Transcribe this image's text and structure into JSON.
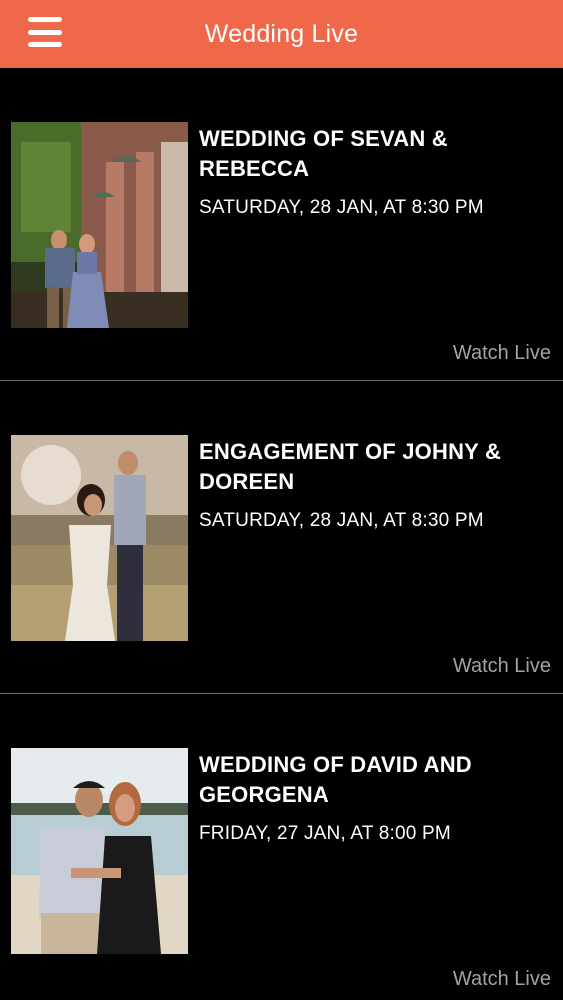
{
  "header": {
    "title": "Wedding Live",
    "menu_icon": "hamburger-menu-icon",
    "background": "#f0684a"
  },
  "events": [
    {
      "title": "WEDDING OF SEVAN & REBECCA",
      "date": "SATURDAY, 28 JAN, AT 8:30 PM",
      "action": "Watch Live"
    },
    {
      "title": "ENGAGEMENT OF JOHNY & DOREEN",
      "date": "SATURDAY, 28 JAN, AT 8:30 PM",
      "action": "Watch Live"
    },
    {
      "title": "WEDDING OF DAVID AND GEORGENA",
      "date": "FRIDAY, 27 JAN, AT 8:00 PM",
      "action": "Watch Live"
    }
  ]
}
